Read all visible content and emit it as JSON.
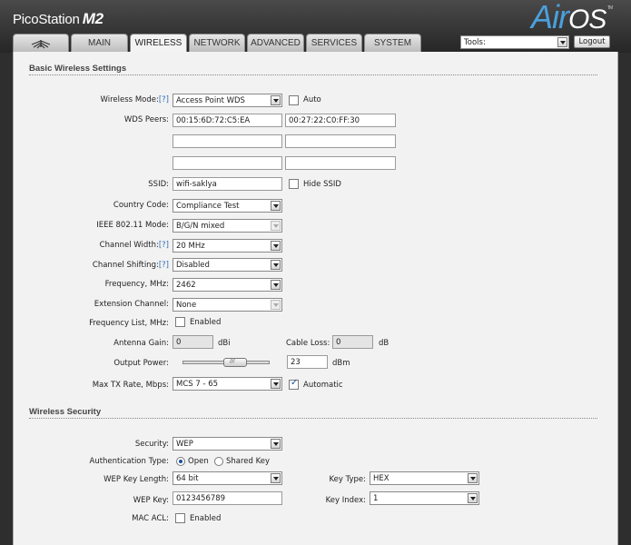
{
  "header": {
    "brand": "PicoStation",
    "model": "M2",
    "logo_air": "Air",
    "logo_os": "OS",
    "logo_mark": "TM"
  },
  "tabs": [
    {
      "label": "",
      "icon": "ubiquiti-logo-icon"
    },
    {
      "label": "MAIN"
    },
    {
      "label": "WIRELESS",
      "active": true
    },
    {
      "label": "NETWORK"
    },
    {
      "label": "ADVANCED"
    },
    {
      "label": "SERVICES"
    },
    {
      "label": "SYSTEM"
    }
  ],
  "toolbar": {
    "tools_value": "Tools:",
    "logout_label": "Logout"
  },
  "basic": {
    "title": "Basic Wireless Settings",
    "help": "[?]",
    "wireless_mode_label": "Wireless Mode:",
    "wireless_mode_value": "Access Point WDS",
    "auto_label": "Auto",
    "wds_peers_label": "WDS Peers:",
    "wds_peers": [
      "00:15:6D:72:C5:EA",
      "00:27:22:C0:FF:30",
      "",
      "",
      "",
      ""
    ],
    "ssid_label": "SSID:",
    "ssid_value": "wifi-saklya",
    "hide_ssid_label": "Hide SSID",
    "country_label": "Country Code:",
    "country_value": "Compliance Test",
    "ieee_label": "IEEE 802.11 Mode:",
    "ieee_value": "B/G/N mixed",
    "channel_width_label": "Channel Width:",
    "channel_width_value": "20 MHz",
    "channel_shift_label": "Channel Shifting:",
    "channel_shift_value": "Disabled",
    "frequency_label": "Frequency, MHz:",
    "frequency_value": "2462",
    "ext_channel_label": "Extension Channel:",
    "ext_channel_value": "None",
    "freq_list_label": "Frequency List, MHz:",
    "enabled_label": "Enabled",
    "antenna_gain_label": "Antenna Gain:",
    "antenna_gain_value": "0",
    "dbi_unit": "dBi",
    "cable_loss_label": "Cable Loss:",
    "cable_loss_value": "0",
    "db_unit": "dB",
    "output_power_label": "Output Power:",
    "output_power_value": "23",
    "dbm_unit": "dBm",
    "output_power_slider_fraction": 0.64,
    "max_tx_label": "Max TX Rate, Mbps:",
    "max_tx_value": "MCS 7 - 65",
    "automatic_label": "Automatic"
  },
  "security": {
    "title": "Wireless Security",
    "security_label": "Security:",
    "security_value": "WEP",
    "auth_label": "Authentication Type:",
    "auth_open": "Open",
    "auth_shared": "Shared Key",
    "key_length_label": "WEP Key Length:",
    "key_length_value": "64 bit",
    "key_type_label": "Key Type:",
    "key_type_value": "HEX",
    "wep_key_label": "WEP Key:",
    "wep_key_value": "0123456789",
    "key_index_label": "Key Index:",
    "key_index_value": "1",
    "mac_acl_label": "MAC ACL:",
    "enabled_label": "Enabled"
  },
  "colors": {
    "header_bg": "#2e2e2e",
    "panel_bg": "#f2f2f2",
    "logo_blue": "#4aa0dc",
    "help_link": "#2b6fb8"
  }
}
